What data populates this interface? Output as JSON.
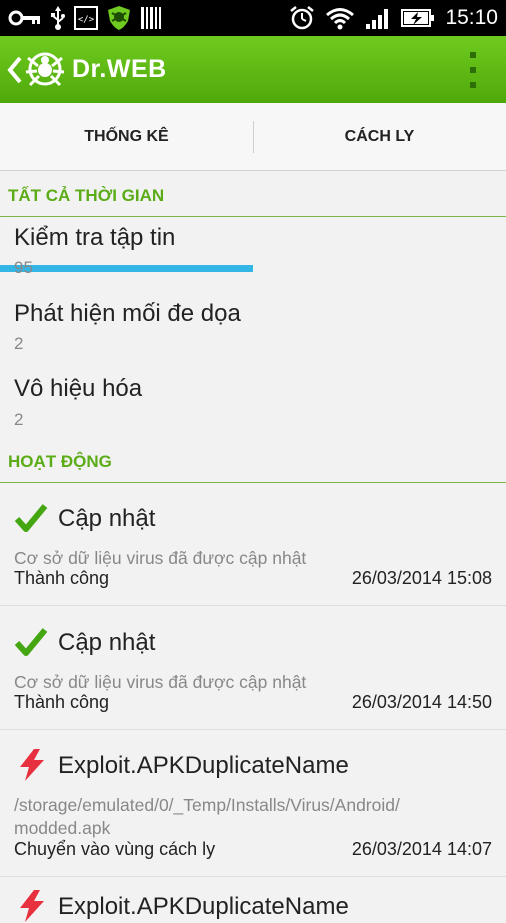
{
  "status_bar": {
    "time": "15:10",
    "icons": [
      "key-icon",
      "usb-icon",
      "developer-icon",
      "drweb-shield-icon",
      "barcode-icon",
      "alarm-icon",
      "wifi-icon",
      "signal-icon",
      "battery-charging-icon"
    ]
  },
  "app_bar": {
    "brand": "Dr.WEB",
    "colors": {
      "green": "#5bb414",
      "accent": "#33b5e5"
    }
  },
  "tabs": [
    {
      "label": "THỐNG KÊ",
      "selected": true
    },
    {
      "label": "CÁCH LY",
      "selected": false
    }
  ],
  "all_time": {
    "header": "TẤT CẢ THỜI GIAN",
    "stats": [
      {
        "title": "Kiểm tra tập tin",
        "value": "95"
      },
      {
        "title": "Phát hiện mối đe dọa",
        "value": "2"
      },
      {
        "title": "Vô hiệu hóa",
        "value": "2"
      }
    ]
  },
  "activity": {
    "header": "HOẠT ĐỘNG",
    "items": [
      {
        "icon": "checkmark-icon",
        "title": "Cập nhật",
        "desc": "Cơ sở dữ liệu virus đã được cập nhật",
        "status": "Thành công",
        "time": "26/03/2014 15:08"
      },
      {
        "icon": "checkmark-icon",
        "title": "Cập nhật",
        "desc": "Cơ sở dữ liệu virus đã được cập nhật",
        "status": "Thành công",
        "time": "26/03/2014 14:50"
      },
      {
        "icon": "threat-bolt-icon",
        "title": "Exploit.APKDuplicateName",
        "desc": "/storage/emulated/0/_Temp/Installs/Virus/Android/ modded.apk",
        "status": "Chuyển vào vùng cách ly",
        "time": "26/03/2014 14:07"
      },
      {
        "icon": "threat-bolt-icon",
        "title": "Exploit.APKDuplicateName",
        "desc": "",
        "status": "",
        "time": ""
      }
    ]
  }
}
